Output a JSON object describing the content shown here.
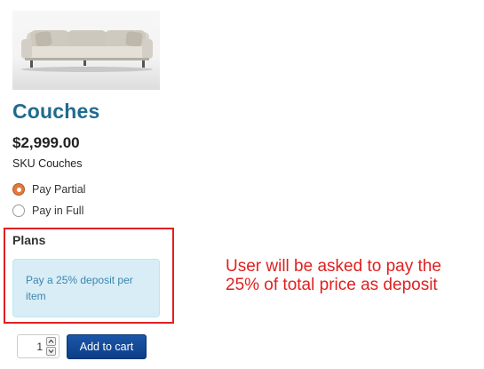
{
  "product": {
    "image_icon": "sofa-icon",
    "title": "Couches",
    "price": "$2,999.00",
    "sku": "SKU Couches"
  },
  "payment": {
    "options": [
      {
        "label": "Pay Partial",
        "selected": true
      },
      {
        "label": "Pay in Full",
        "selected": false
      }
    ]
  },
  "plans": {
    "heading": "Plans",
    "description": "Pay a 25% deposit per item"
  },
  "annotation": {
    "text": "User will be asked to pay the\n25% of total price as deposit",
    "color": "#e02020"
  },
  "cart": {
    "quantity": "1",
    "add_label": "Add to cart",
    "button_color": "#1c56a8"
  },
  "colors": {
    "title": "#1f6b8f",
    "radio_selected": "#e17a3f",
    "plan_bg": "#d9edf7",
    "plan_text": "#3a87ad"
  }
}
